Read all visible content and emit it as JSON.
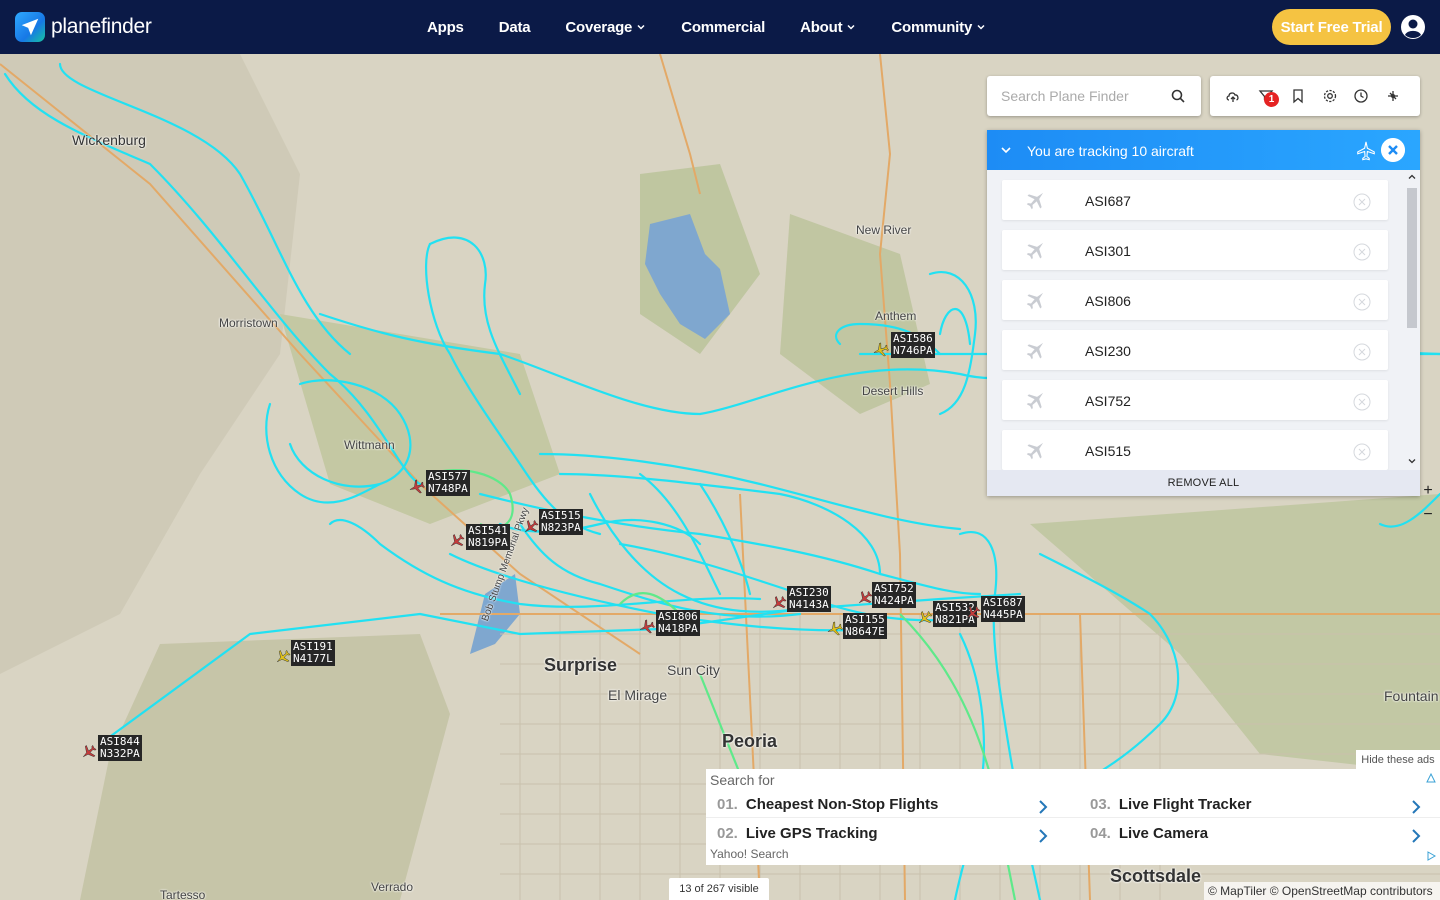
{
  "brand": {
    "name": "planefinder"
  },
  "nav": [
    {
      "label": "Apps",
      "dropdown": false
    },
    {
      "label": "Data",
      "dropdown": false
    },
    {
      "label": "Coverage",
      "dropdown": true
    },
    {
      "label": "Commercial",
      "dropdown": false
    },
    {
      "label": "About",
      "dropdown": true
    },
    {
      "label": "Community",
      "dropdown": true
    }
  ],
  "cta": {
    "label": "Start Free Trial"
  },
  "search": {
    "placeholder": "Search Plane Finder"
  },
  "toolbar": {
    "icons": [
      "cloud-upload-icon",
      "filter-icon",
      "bookmark-icon",
      "settings-icon",
      "history-icon",
      "ar-plane-icon"
    ],
    "filter_badge": "1"
  },
  "tracking": {
    "title": "You are tracking 10 aircraft",
    "items": [
      "ASI687",
      "ASI301",
      "ASI806",
      "ASI230",
      "ASI752",
      "ASI515"
    ],
    "remove_all": "REMOVE ALL"
  },
  "map": {
    "places": [
      {
        "name": "Wickenburg"
      },
      {
        "name": "Morristown"
      },
      {
        "name": "Wittmann"
      },
      {
        "name": "New River"
      },
      {
        "name": "Anthem"
      },
      {
        "name": "Desert Hills"
      },
      {
        "name": "Surprise"
      },
      {
        "name": "Sun City"
      },
      {
        "name": "El Mirage"
      },
      {
        "name": "Peoria"
      },
      {
        "name": "Fountain"
      },
      {
        "name": "Scottsdale"
      },
      {
        "name": "Tartesso"
      },
      {
        "name": "Verrado"
      },
      {
        "name": "Bob Stump Memorial Pkwy"
      }
    ],
    "aircraft": [
      {
        "callsign": "ASI577",
        "reg": "N748PA",
        "color": "#c43b3b"
      },
      {
        "callsign": "ASI515",
        "reg": "N823PA",
        "color": "#c43b3b"
      },
      {
        "callsign": "ASI541",
        "reg": "N819PA",
        "color": "#c43b3b"
      },
      {
        "callsign": "ASI806",
        "reg": "N418PA",
        "color": "#c43b3b"
      },
      {
        "callsign": "ASI230",
        "reg": "N4143A",
        "color": "#c43b3b"
      },
      {
        "callsign": "ASI752",
        "reg": "N424PA",
        "color": "#c43b3b"
      },
      {
        "callsign": "ASI155",
        "reg": "N8647E",
        "color": "#e0c21a"
      },
      {
        "callsign": "ASI532",
        "reg": "N821PA",
        "color": "#e0c21a"
      },
      {
        "callsign": "ASI687",
        "reg": "N445PA",
        "color": "#c43b3b"
      },
      {
        "callsign": "ASI586",
        "reg": "N746PA",
        "color": "#e0c21a"
      },
      {
        "callsign": "ASI191",
        "reg": "N4177L",
        "color": "#e0c21a"
      },
      {
        "callsign": "ASI844",
        "reg": "N332PA",
        "color": "#c43b3b"
      }
    ],
    "zoom_in": "+",
    "zoom_out": "−"
  },
  "ads": {
    "hide_label": "Hide these ads",
    "heading": "Search for",
    "items": [
      {
        "num": "01.",
        "label": "Cheapest Non-Stop Flights"
      },
      {
        "num": "03.",
        "label": "Live Flight Tracker"
      },
      {
        "num": "02.",
        "label": "Live GPS Tracking"
      },
      {
        "num": "04.",
        "label": "Live Camera"
      }
    ],
    "footer": "Yahoo! Search"
  },
  "status": {
    "visible": "13 of 267 visible"
  },
  "attribution": "© MapTiler © OpenStreetMap contributors"
}
